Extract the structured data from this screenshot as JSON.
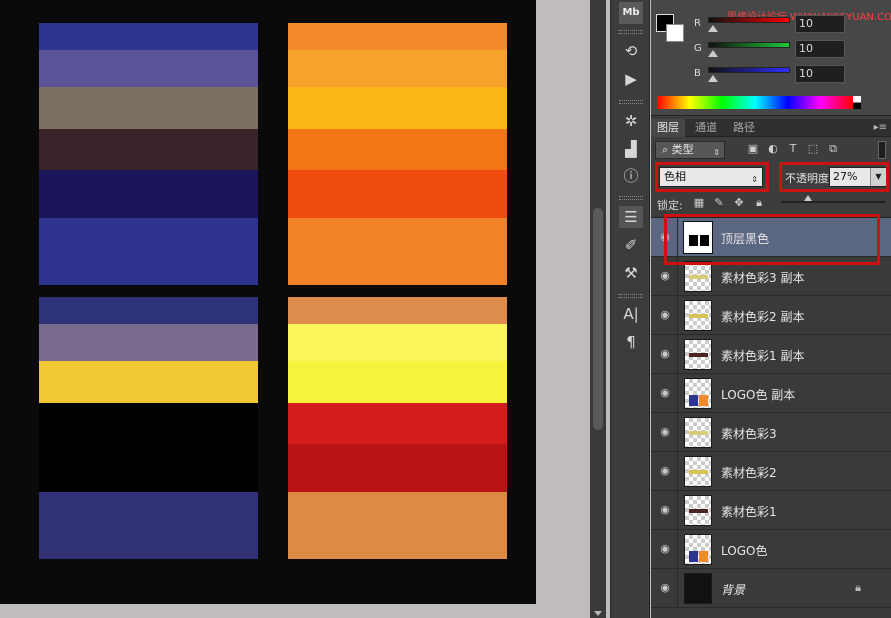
{
  "canvas": {
    "panels": [
      {
        "stripes": [
          "#2e3590",
          "#5a5398",
          "#7c7064",
          "#3b2429",
          "#1b1659",
          "#2e338f"
        ]
      },
      {
        "stripes": [
          "#f28a2a",
          "#f7a229",
          "#fbb715",
          "#f27714",
          "#ee4c0c",
          "#f18226"
        ]
      },
      {
        "stripes": [
          "#2e3277",
          "#7a6b8f",
          "#f1c935",
          "#000000",
          "#000000",
          "#313276"
        ]
      },
      {
        "stripes": [
          "#dd8c4c",
          "#f9f55a",
          "#f7f43d",
          "#d41d1a",
          "#b81315",
          "#dd8a44"
        ]
      }
    ]
  },
  "color_panel": {
    "watermark": "思缘设计论坛 WWW.MISSYUAN.COM",
    "channels": [
      {
        "label": "R",
        "value": "10"
      },
      {
        "label": "G",
        "value": "10"
      },
      {
        "label": "B",
        "value": "10"
      }
    ]
  },
  "toolstrip": {
    "top_badge": "Mb",
    "tools": [
      "history-icon",
      "play-icon",
      "wheel-icon",
      "histogram-icon",
      "info-icon",
      "adjust-icon",
      "brush-icon",
      "stamp-icon",
      "character-icon",
      "paragraph-icon"
    ]
  },
  "layers_panel": {
    "tabs": [
      "图层",
      "通道",
      "路径"
    ],
    "filter_kind": "类型",
    "blend_mode": "色相",
    "opacity_label": "不透明度:",
    "opacity_value": "27%",
    "lock_label": "锁定:",
    "layers": [
      {
        "name": "顶层黑色",
        "selected": true,
        "thumb": "black-bars"
      },
      {
        "name": "素材色彩3 副本",
        "thumb": "#d9cc79"
      },
      {
        "name": "素材色彩2 副本",
        "thumb": "#d8c253"
      },
      {
        "name": "素材色彩1 副本",
        "thumb": "#4a2323"
      },
      {
        "name": "LOGO色 副本",
        "thumb": "logo"
      },
      {
        "name": "素材色彩3",
        "thumb": "#d9cc79"
      },
      {
        "name": "素材色彩2",
        "thumb": "#d8c253"
      },
      {
        "name": "素材色彩1",
        "thumb": "#4a2323"
      },
      {
        "name": "LOGO色",
        "thumb": "logo"
      },
      {
        "name": "背景",
        "thumb": "#111111",
        "locked": true
      }
    ]
  }
}
